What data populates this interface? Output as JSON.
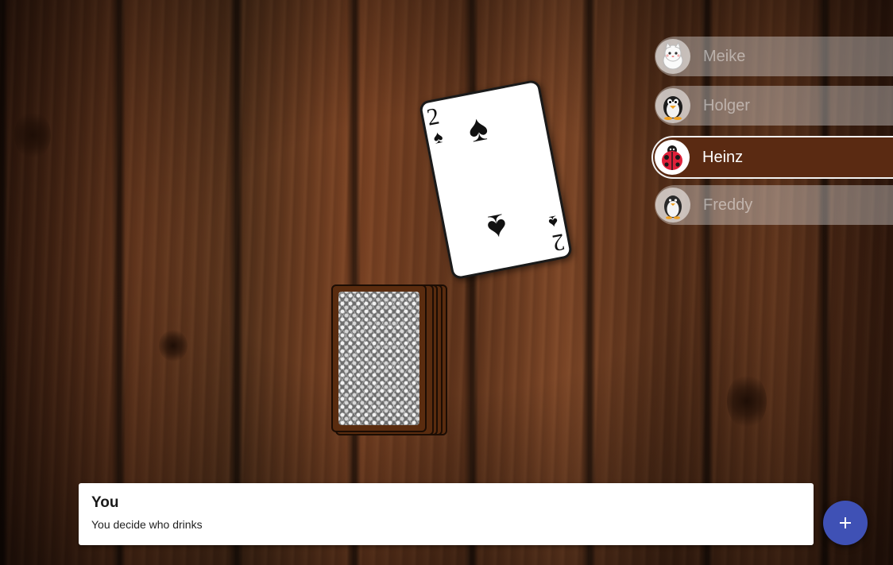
{
  "played_card": {
    "rank": "2",
    "suit": "♠",
    "suit_name": "spades"
  },
  "deck": {
    "label": ""
  },
  "players": [
    {
      "name": "Meike",
      "avatar": "cat-avatar-icon",
      "active": false
    },
    {
      "name": "Holger",
      "avatar": "penguin-avatar-icon",
      "active": false
    },
    {
      "name": "Heinz",
      "avatar": "ladybug-avatar-icon",
      "active": true
    },
    {
      "name": "Freddy",
      "avatar": "penguin-avatar-icon",
      "active": false
    }
  ],
  "message": {
    "title": "You",
    "text": "You decide who drinks"
  },
  "fab": {
    "icon": "plus-icon",
    "color": "#3f51b5"
  },
  "colors": {
    "active_player_bg": "#5a2a12",
    "table_wood": "#5e331b"
  }
}
